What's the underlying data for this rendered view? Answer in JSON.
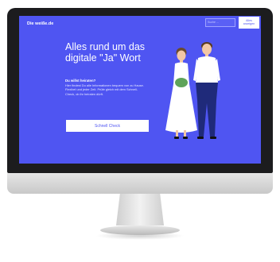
{
  "site": {
    "logo": "Die weiße.de",
    "search_placeholder": "Suche ...",
    "header_button": "Alles\nanzeigen"
  },
  "hero": {
    "headline": "Alles rund um das digitale \"Ja\" Wort",
    "subtitle": "Du willst heiraten?",
    "body": "Hier findest Du alle Informationen bequem von zu Hause. Flexibel und jeder Zeit. Prüfe gleich mit dem Schnell-Check, ob ihr heiraten dürft.",
    "cta_label": "Schnell Check"
  },
  "colors": {
    "screen_bg": "#4f55f2",
    "bride_dress": "#ffffff",
    "groom_suit": "#1f2a7a",
    "bouquet": "#5fa35a"
  },
  "icons": {
    "illustration": "wedding-couple-illustration"
  }
}
